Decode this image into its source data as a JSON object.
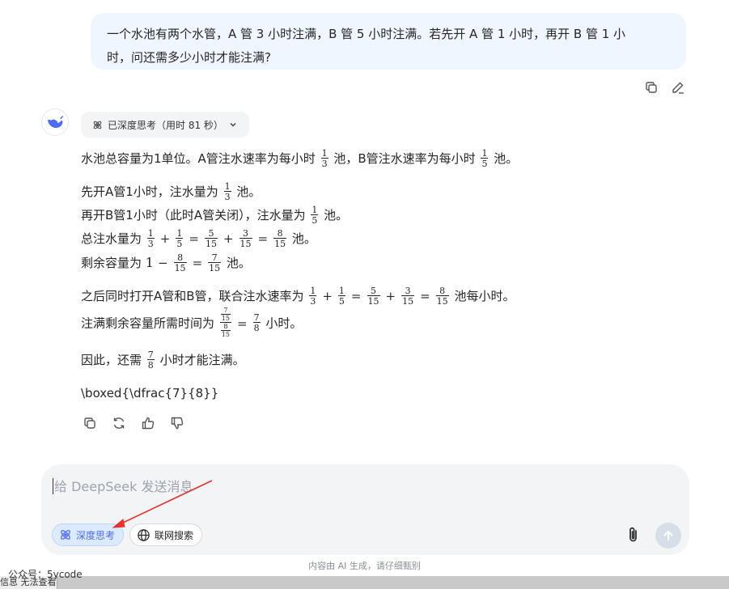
{
  "question": {
    "line1": "一个水池有两个水管，A 管 3 小时注满，B 管 5 小时注满。若先开 A 管 1 小时，再开 B 管 1 小",
    "line2": "时，问还需多少小时才能注满?",
    "copy_icon": "copy-icon",
    "edit_icon": "pencil-icon"
  },
  "assistant": {
    "avatar_icon": "deepseek-whale-icon",
    "thinking_label": "已深度思考（用时 81 秒）",
    "thinking_icon": "atom-icon",
    "chevron_icon": "chevron-down-icon",
    "para1": {
      "a": "水池总容量为1单位。A管注水速率为每小时",
      "b": "池，B管注水速率为每小时",
      "c": "池。"
    },
    "para2": {
      "l1a": "先开A管1小时，注水量为",
      "l1b": "池。",
      "l2a": "再开B管1小时（此时A管关闭），注水量为",
      "l2b": "池。",
      "l3a": "总注水量为",
      "l3b": "池。",
      "l4a": "剩余容量为",
      "l4b": "池。"
    },
    "para3": {
      "l1a": "之后同时打开A管和B管，联合注水速率为",
      "l1b": "池每小时。",
      "l2a": "注满剩余容量所需时间为",
      "l2b": "小时。"
    },
    "para4": {
      "a": "因此，还需",
      "b": "小时才能注满。"
    },
    "boxed": "\\boxed{\\dfrac{7}{8}}",
    "math": {
      "one": "1",
      "three": "3",
      "five": "5",
      "seven": "7",
      "eight": "8",
      "fifteen": "15",
      "plus": "+",
      "minus": "−",
      "eq": "="
    },
    "action_icons": [
      "copy-icon",
      "regenerate-icon",
      "thumbs-up-icon",
      "thumbs-down-icon"
    ]
  },
  "composer": {
    "placeholder": "给 DeepSeek 发送消息",
    "deep_think_label": "深度思考",
    "deep_think_active": true,
    "web_search_label": "联网搜索",
    "attach_icon": "paperclip-icon",
    "send_icon": "arrow-up-icon"
  },
  "disclaimer": "内容由 AI 生成，请仔细甄别",
  "watermark": "公众号：5ycode",
  "taskbar_text": "信息 无法查看]",
  "colors": {
    "accent": "#4d6bfe",
    "user_bubble": "#eff6ff",
    "composer_bg": "#f3f4f6",
    "annotation_arrow": "#e8322c"
  }
}
